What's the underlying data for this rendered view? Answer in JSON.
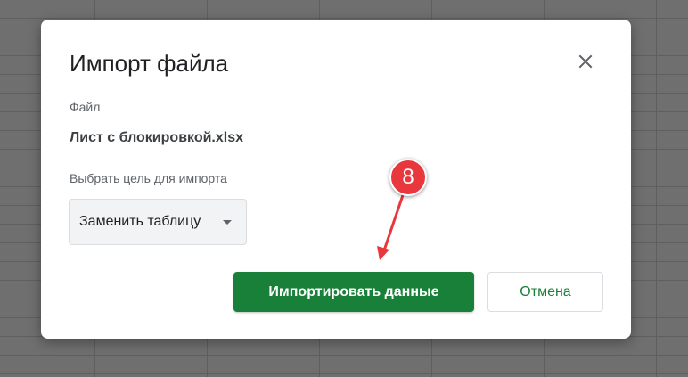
{
  "dialog": {
    "title": "Импорт файла",
    "file_label": "Файл",
    "file_name": "Лист с блокировкой.xlsx",
    "target_label": "Выбрать цель для импорта",
    "target_selected": "Заменить таблицу",
    "import_label": "Импортировать данные",
    "cancel_label": "Отмена"
  },
  "annotation": {
    "step_number": "8"
  },
  "icons": {
    "close": "close-icon",
    "dropdown": "chevron-down-icon"
  },
  "colors": {
    "primary_green": "#188038",
    "badge_red": "#e8383d"
  }
}
